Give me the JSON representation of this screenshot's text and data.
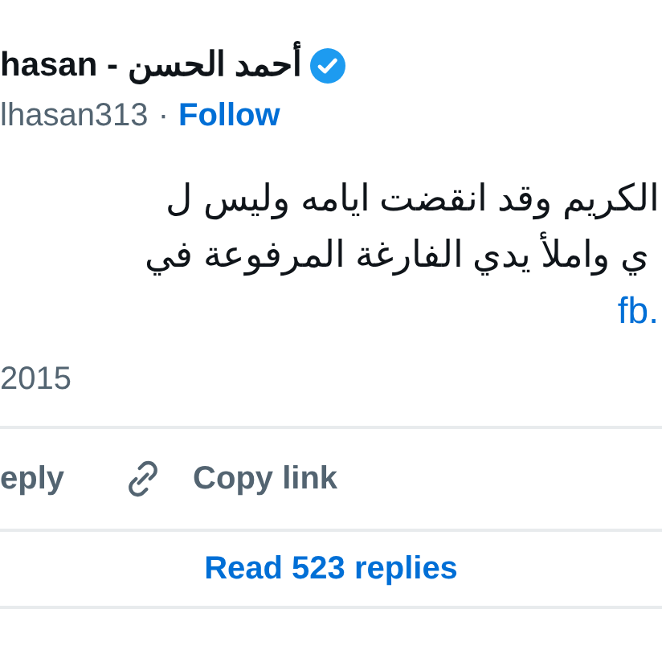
{
  "author": {
    "display_name": "hasan - أحمد الحسن",
    "verified": true,
    "handle": "lhasan313",
    "separator": "·",
    "follow": "Follow"
  },
  "text_lines": [
    "الكريم وقد انقضت ايامه وليس ل",
    "ي واملأ يدي الفارغة المرفوعة في"
  ],
  "link": "fb.",
  "date": "2015",
  "actions": [
    {
      "label": "eply",
      "kind": "text"
    },
    {
      "label": "Copy link",
      "kind": "link"
    }
  ],
  "read_replies": "Read 523 replies"
}
